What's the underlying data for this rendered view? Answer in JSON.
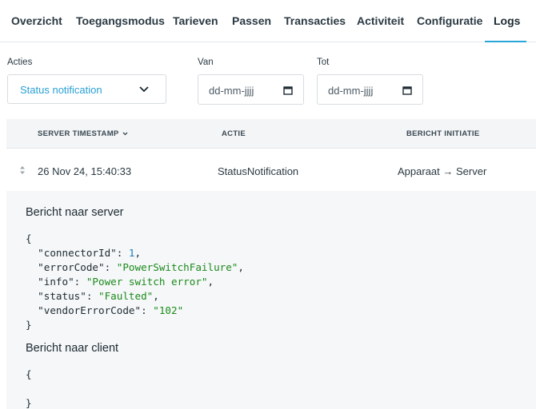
{
  "tabs": [
    {
      "label": "Overzicht"
    },
    {
      "label": "Toegangsmodus"
    },
    {
      "label": "Tarieven"
    },
    {
      "label": "Passen"
    },
    {
      "label": "Transacties"
    },
    {
      "label": "Activiteit"
    },
    {
      "label": "Configuratie"
    },
    {
      "label": "Logs",
      "active": true
    }
  ],
  "colors": {
    "accent": "#2aa7d8",
    "select_text": "#2aa0d4",
    "json_string": "#1c8a1c",
    "json_number": "#1a7fb8"
  },
  "filters": {
    "acties_label": "Acties",
    "acties_value": "Status notification",
    "van_label": "Van",
    "van_placeholder": "dd-mm-jjjj",
    "tot_label": "Tot",
    "tot_placeholder": "dd-mm-jjjj"
  },
  "table": {
    "headers": {
      "timestamp": "SERVER TIMESTAMP",
      "action": "ACTIE",
      "initiation": "BERICHT INITIATIE"
    },
    "rows": [
      {
        "timestamp": "26 Nov 24, 15:40:33",
        "action": "StatusNotification",
        "initiation": "Apparaat → Server"
      }
    ]
  },
  "detail": {
    "server_title": "Bericht naar server",
    "server_payload": {
      "connectorId": 1,
      "errorCode": "PowerSwitchFailure",
      "info": "Power switch error",
      "status": "Faulted",
      "vendorErrorCode": "102"
    },
    "client_title": "Bericht naar client",
    "client_payload": {}
  }
}
